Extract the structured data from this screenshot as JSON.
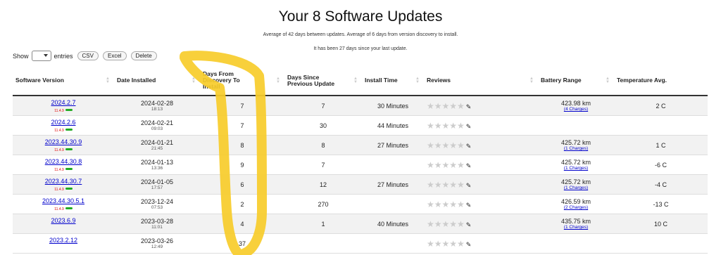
{
  "title": "Your 8 Software Updates",
  "subtitle1": "Average of 42 days between updates. Average of 6 days from version discovery to install.",
  "subtitle2": "It has been 27 days since your last update.",
  "controls": {
    "show_label": "Show",
    "entries_label": "entries",
    "csv": "CSV",
    "excel": "Excel",
    "delete": "Delete"
  },
  "headers": {
    "version": "Software Version",
    "date": "Date Installed",
    "discovery": "Days From Discovery To Install",
    "since": "Days Since Previous Update",
    "install_time": "Install Time",
    "reviews": "Reviews",
    "battery": "Battery Range",
    "temp": "Temperature Avg."
  },
  "rows": [
    {
      "version": "2024.2.7",
      "tag": "11.4.9",
      "date": "2024-02-28",
      "time": "18:13",
      "discovery": "7",
      "since": "7",
      "install_time": "30 Minutes",
      "battery": "423.98 km",
      "charges": "(4 Charges)",
      "temp": "2 C"
    },
    {
      "version": "2024.2.6",
      "tag": "11.4.9",
      "date": "2024-02-21",
      "time": "09:03",
      "discovery": "7",
      "since": "30",
      "install_time": "44 Minutes",
      "battery": "",
      "charges": "",
      "temp": ""
    },
    {
      "version": "2023.44.30.9",
      "tag": "11.4.9",
      "date": "2024-01-21",
      "time": "21:45",
      "discovery": "8",
      "since": "8",
      "install_time": "27 Minutes",
      "battery": "425.72 km",
      "charges": "(1 Charges)",
      "temp": "1 C"
    },
    {
      "version": "2023.44.30.8",
      "tag": "11.4.9",
      "date": "2024-01-13",
      "time": "13:36",
      "discovery": "9",
      "since": "7",
      "install_time": "",
      "battery": "425.72 km",
      "charges": "(1 Charges)",
      "temp": "-6 C"
    },
    {
      "version": "2023.44.30.7",
      "tag": "11.4.9",
      "date": "2024-01-05",
      "time": "17:57",
      "discovery": "6",
      "since": "12",
      "install_time": "27 Minutes",
      "battery": "425.72 km",
      "charges": "(1 Charges)",
      "temp": "-4 C"
    },
    {
      "version": "2023.44.30.5.1",
      "tag": "11.4.9",
      "date": "2023-12-24",
      "time": "07:53",
      "discovery": "2",
      "since": "270",
      "install_time": "",
      "battery": "426.59 km",
      "charges": "(2 Charges)",
      "temp": "-13 C"
    },
    {
      "version": "2023.6.9",
      "tag": "",
      "date": "2023-03-28",
      "time": "11:01",
      "discovery": "4",
      "since": "1",
      "install_time": "40 Minutes",
      "battery": "435.75 km",
      "charges": "(1 Charges)",
      "temp": "10 C"
    },
    {
      "version": "2023.2.12",
      "tag": "",
      "date": "2023-03-26",
      "time": "12:49",
      "discovery": "37",
      "since": "",
      "install_time": "",
      "battery": "",
      "charges": "",
      "temp": ""
    }
  ],
  "colors": {
    "highlight": "#f7cc2a",
    "link": "#0000cc"
  }
}
